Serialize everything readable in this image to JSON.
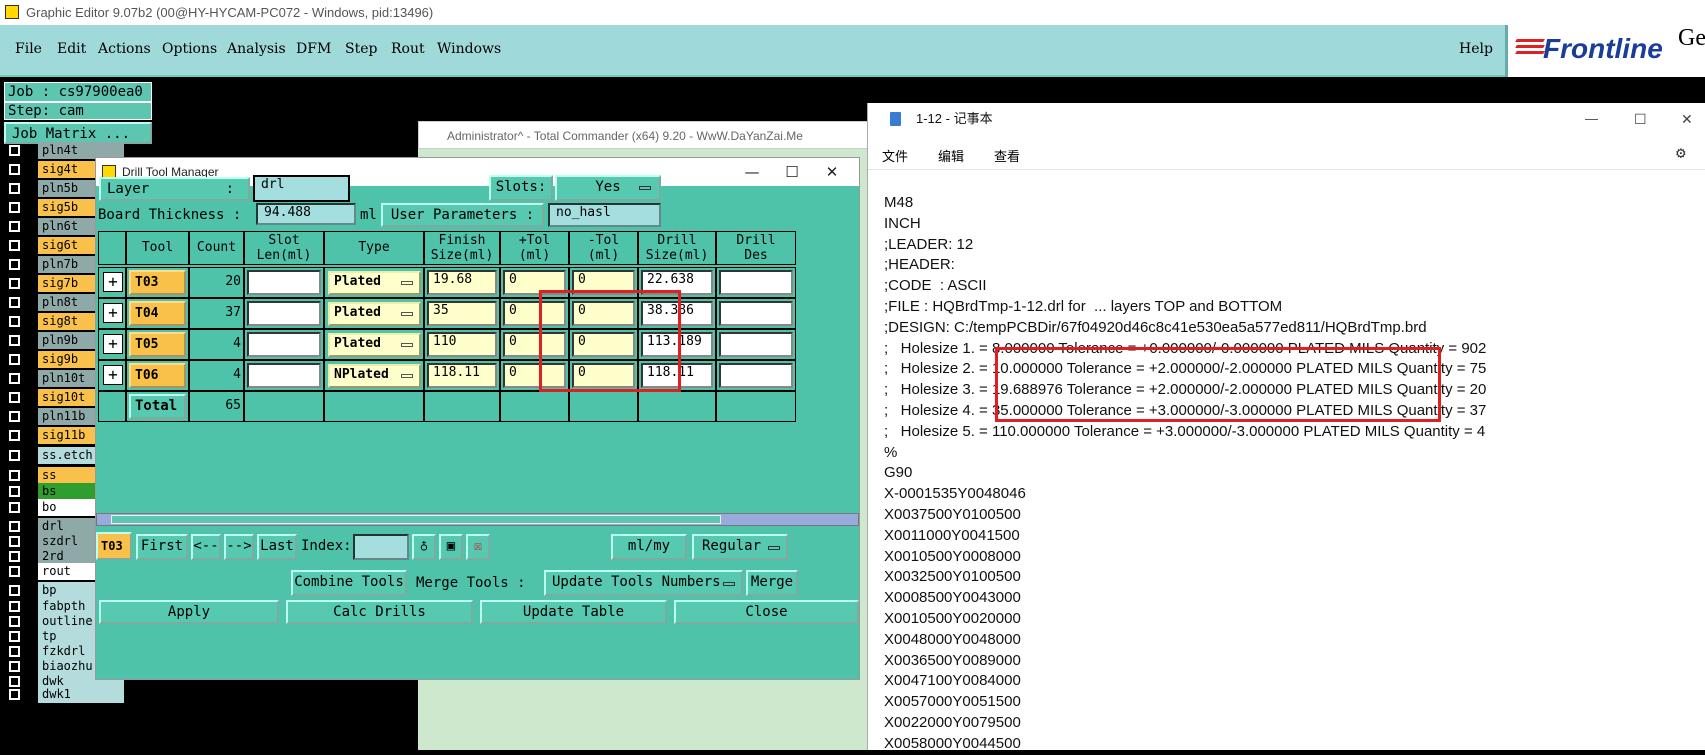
{
  "window_title": "Graphic Editor 9.07b2 (00@HY-HYCAM-PC072 - Windows, pid:13496)",
  "menu": [
    "File",
    "Edit",
    "Actions",
    "Options",
    "Analysis",
    "DFM",
    "Step",
    "Rout",
    "Windows"
  ],
  "help": "Help",
  "logo": {
    "text": "Frontline",
    "extra": "Ge"
  },
  "left": {
    "job": "Job : cs97900ea0",
    "step": "Step: cam",
    "job_matrix": "Job Matrix ...",
    "layers": [
      {
        "name": "pln4t",
        "color": "#8fa8a8"
      },
      {
        "name": "sig4t",
        "color": "#f9c14a"
      },
      {
        "name": "pln5b",
        "color": "#8fa8a8"
      },
      {
        "name": "sig5b",
        "color": "#f9c14a"
      },
      {
        "name": "pln6t",
        "color": "#8fa8a8"
      },
      {
        "name": "sig6t",
        "color": "#f9c14a"
      },
      {
        "name": "pln7b",
        "color": "#8fa8a8"
      },
      {
        "name": "sig7b",
        "color": "#f9c14a"
      },
      {
        "name": "pln8t",
        "color": "#8fa8a8"
      },
      {
        "name": "sig8t",
        "color": "#f9c14a"
      },
      {
        "name": "pln9b",
        "color": "#8fa8a8"
      },
      {
        "name": "sig9b",
        "color": "#f9c14a"
      },
      {
        "name": "pln10t",
        "color": "#8fa8a8"
      },
      {
        "name": "sig10t",
        "color": "#f9c14a"
      },
      {
        "name": "pln11b",
        "color": "#8fa8a8"
      },
      {
        "name": "sig11b",
        "color": "#f9c14a"
      },
      {
        "name": "ss.etch",
        "color": "#b5dcdc"
      },
      {
        "name": "ss",
        "color": "#f9c14a"
      },
      {
        "name": "bs",
        "color": "#2e9e2e"
      },
      {
        "name": "bo",
        "color": "#ffffff"
      },
      {
        "name": "drl",
        "color": "#8fa8a8"
      },
      {
        "name": "szdrl",
        "color": "#8fa8a8"
      },
      {
        "name": "2rd",
        "color": "#8fa8a8"
      },
      {
        "name": "rout",
        "color": "#ffffff"
      },
      {
        "name": "bp",
        "color": "#b5dcdc"
      },
      {
        "name": "fabpth",
        "color": "#b5dcdc"
      },
      {
        "name": "outline",
        "color": "#b5dcdc"
      },
      {
        "name": "tp",
        "color": "#b5dcdc"
      },
      {
        "name": "fzkdrl",
        "color": "#b5dcdc"
      },
      {
        "name": "biaozhu",
        "color": "#b5dcdc"
      },
      {
        "name": "dwk",
        "color": "#b5dcdc"
      },
      {
        "name": "dwk1",
        "color": "#b5dcdc"
      }
    ]
  },
  "tcmd_title": "Administrator^ - Total Commander (x64) 9.20 - WwW.DaYanZai.Me",
  "drill": {
    "title": "Drill Tool Manager",
    "layer_label": "Layer",
    "layer_colon": ":",
    "layer_value": "drl",
    "slots_label": "Slots:",
    "slots_value": "Yes",
    "board_thickness_label": "Board Thickness :",
    "board_thickness_value": "94.488",
    "thickness_unit": "ml",
    "user_params_label": "User Parameters :",
    "user_params_value": "no_hasl",
    "columns": [
      "Tool",
      "Count",
      "Slot\nLen(ml)",
      "Type",
      "Finish\nSize(ml)",
      "+Tol\n(ml)",
      "-Tol\n(ml)",
      "Drill\nSize(ml)",
      "Drill\nDes"
    ],
    "rows": [
      {
        "tool": "T03",
        "count": "20",
        "type": "Plated",
        "finish": "19.68",
        "ptol": "0",
        "mtol": "0",
        "drill": "22.638"
      },
      {
        "tool": "T04",
        "count": "37",
        "type": "Plated",
        "finish": "35",
        "ptol": "0",
        "mtol": "0",
        "drill": "38.386"
      },
      {
        "tool": "T05",
        "count": "4",
        "type": "Plated",
        "finish": "110",
        "ptol": "0",
        "mtol": "0",
        "drill": "113.189"
      },
      {
        "tool": "T06",
        "count": "4",
        "type": "NPlated",
        "finish": "118.11",
        "ptol": "0",
        "mtol": "0",
        "drill": "118.11"
      }
    ],
    "total_label": "Total",
    "total_count": "65",
    "current_tool": "T03",
    "nav": {
      "first": "First",
      "prev": "<--",
      "next": "-->",
      "last": "Last",
      "index": "Index:"
    },
    "units": "ml/my",
    "mode": "Regular",
    "combine": "Combine Tools",
    "merge_label": "Merge Tools :",
    "merge_option": "Update Tools Numbers",
    "merge": "Merge",
    "apply": "Apply",
    "calc": "Calc Drills",
    "update": "Update Table",
    "close": "Close"
  },
  "notepad": {
    "title": "1-12 - 记事本",
    "menu": [
      "文件",
      "编辑",
      "查看"
    ],
    "lines": [
      "M48",
      "INCH",
      ";LEADER: 12",
      ";HEADER:",
      ";CODE  : ASCII",
      ";FILE : HQBrdTmp-1-12.drl for  ... layers TOP and BOTTOM",
      ";DESIGN: C:/tempPCBDir/67f04920d46c8c41e530ea5a577ed811/HQBrdTmp.brd",
      ";   Holesize 1. = 8.000000 Tolerance = +0.000000/-0.000000 PLATED MILS Quantity = 902",
      ";   Holesize 2. = 10.000000 Tolerance = +2.000000/-2.000000 PLATED MILS Quantity = 75",
      ";   Holesize 3. = 19.688976 Tolerance = +2.000000/-2.000000 PLATED MILS Quantity = 20",
      ";   Holesize 4. = 35.000000 Tolerance = +3.000000/-3.000000 PLATED MILS Quantity = 37",
      ";   Holesize 5. = 110.000000 Tolerance = +3.000000/-3.000000 PLATED MILS Quantity = 4",
      "%",
      "G90",
      "X-0001535Y0048046",
      "X0037500Y0100500",
      "X0011000Y0041500",
      "X0010500Y0008000",
      "X0032500Y0100500",
      "X0008500Y0043000",
      "X0010500Y0020000",
      "X0048000Y0048000",
      "X0036500Y0089000",
      "X0047100Y0084000",
      "X0057000Y0051500",
      "X0022000Y0079500",
      "X0058000Y0044500"
    ]
  }
}
